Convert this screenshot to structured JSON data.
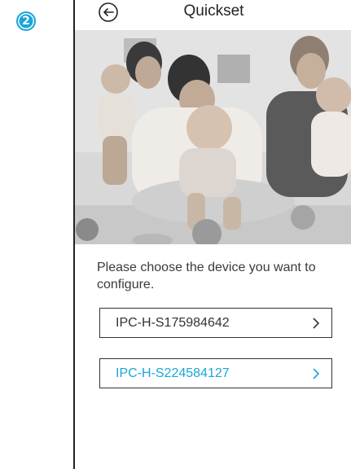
{
  "step": {
    "number": "2"
  },
  "header": {
    "title": "Quickset",
    "back_icon": "arrow-left-circle-icon"
  },
  "hero_image": {
    "description_icon": "family-photo"
  },
  "prompt": "Please choose the device you want to configure.",
  "devices": [
    {
      "id": "IPC-H-S175984642",
      "selected": false
    },
    {
      "id": "IPC-H-S224584127",
      "selected": true
    }
  ],
  "colors": {
    "accent": "#1aa6d8",
    "text": "#333333"
  }
}
